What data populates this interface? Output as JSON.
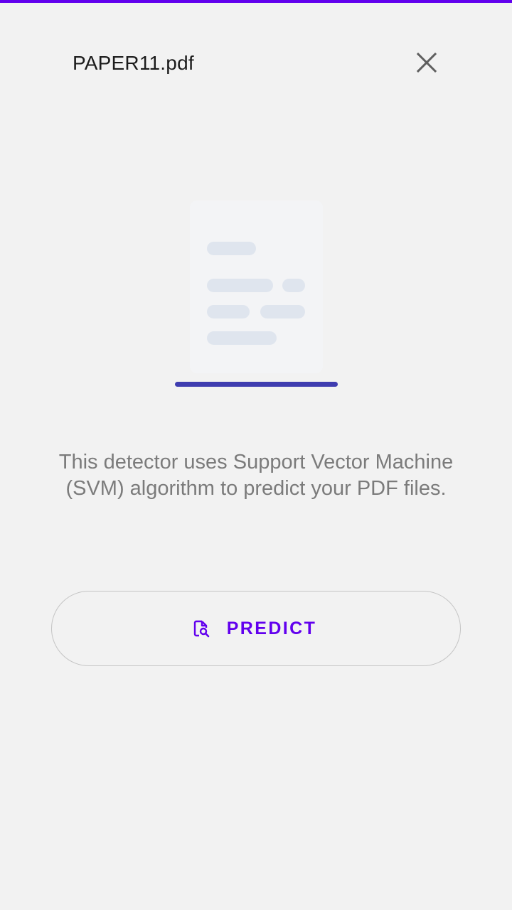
{
  "theme": {
    "accent": "#6200ee",
    "progress": "#3f3db0",
    "background": "#f2f2f2"
  },
  "header": {
    "title": "PAPER11.pdf",
    "close_icon": "close-icon"
  },
  "illustration": {
    "icon": "document-placeholder-icon"
  },
  "body": {
    "description": "This detector uses Support Vector Machine (SVM) algorithm to predict your PDF files."
  },
  "predict_button": {
    "label": "PREDICT",
    "icon": "document-search-icon"
  }
}
